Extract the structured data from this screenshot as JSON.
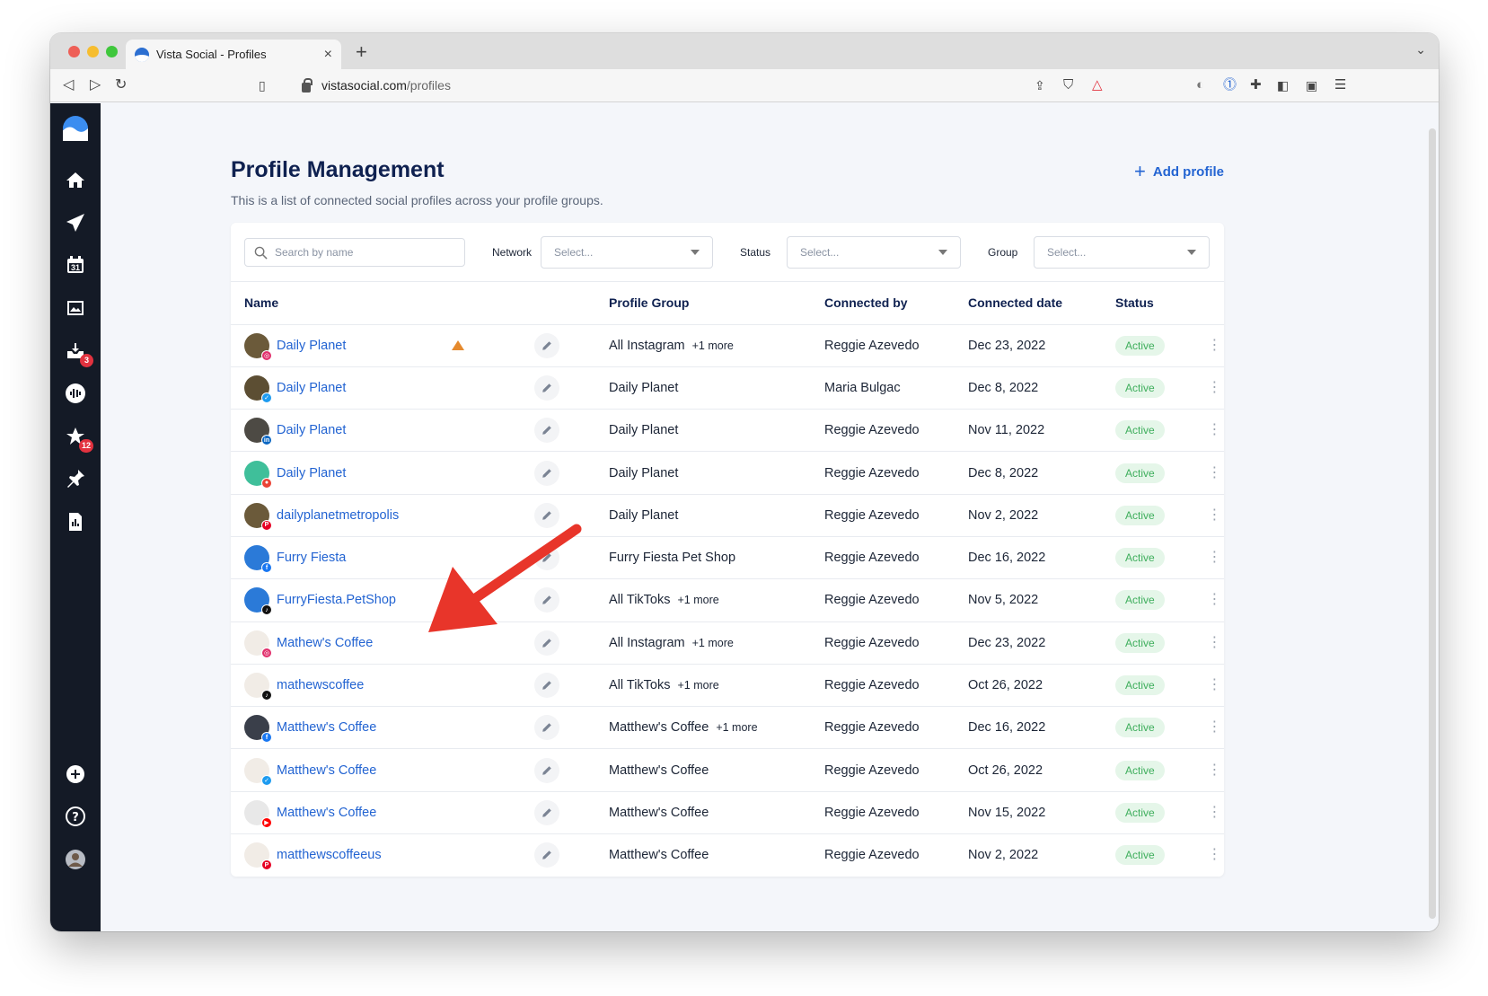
{
  "browser": {
    "tab_title": "Vista Social - Profiles",
    "url_host": "vistasocial.com",
    "url_path": "/profiles"
  },
  "sidebar": {
    "items": [
      {
        "name": "logo",
        "icon": "vista-logo-icon"
      },
      {
        "name": "home",
        "icon": "home-icon"
      },
      {
        "name": "publish",
        "icon": "paper-plane-icon"
      },
      {
        "name": "calendar",
        "icon": "calendar-icon",
        "text": "31"
      },
      {
        "name": "media",
        "icon": "image-icon"
      },
      {
        "name": "inbox",
        "icon": "inbox-icon",
        "badge": "3"
      },
      {
        "name": "listening",
        "icon": "soundwave-icon"
      },
      {
        "name": "reviews",
        "icon": "star-icon",
        "badge": "12"
      },
      {
        "name": "pins",
        "icon": "pin-icon"
      },
      {
        "name": "reports",
        "icon": "report-icon"
      }
    ],
    "bottom": [
      {
        "name": "add",
        "icon": "plus-circle-icon"
      },
      {
        "name": "help",
        "icon": "question-circle-icon"
      },
      {
        "name": "user",
        "icon": "user-avatar-icon"
      }
    ]
  },
  "page": {
    "title": "Profile Management",
    "subtitle": "This is a list of connected social profiles across your profile groups.",
    "add_profile": "Add profile"
  },
  "filters": {
    "search_placeholder": "Search by name",
    "network_label": "Network",
    "network_value": "Select...",
    "status_label": "Status",
    "status_value": "Select...",
    "group_label": "Group",
    "group_value": "Select..."
  },
  "table": {
    "columns": [
      "Name",
      "Profile Group",
      "Connected by",
      "Connected date",
      "Status"
    ],
    "rows": [
      {
        "name": "Daily Planet",
        "network": "instagram",
        "group": "All Instagram",
        "more": "+1 more",
        "by": "Reggie Azevedo",
        "date": "Dec 23, 2022",
        "status": "Active",
        "warning": true,
        "avatar_color": "#6b5a3a"
      },
      {
        "name": "Daily Planet",
        "network": "twitter",
        "group": "Daily Planet",
        "more": "",
        "by": "Maria Bulgac",
        "date": "Dec 8, 2022",
        "status": "Active",
        "avatar_color": "#5c4e33"
      },
      {
        "name": "Daily Planet",
        "network": "linkedin",
        "group": "Daily Planet",
        "more": "",
        "by": "Reggie Azevedo",
        "date": "Nov 11, 2022",
        "status": "Active",
        "avatar_color": "#4d4a44"
      },
      {
        "name": "Daily Planet",
        "network": "google",
        "group": "Daily Planet",
        "more": "",
        "by": "Reggie Azevedo",
        "date": "Dec 8, 2022",
        "status": "Active",
        "avatar_color": "#3fbf9a"
      },
      {
        "name": "dailyplanetmetropolis",
        "network": "pinterest",
        "group": "Daily Planet",
        "more": "",
        "by": "Reggie Azevedo",
        "date": "Nov 2, 2022",
        "status": "Active",
        "avatar_color": "#6b5a3a"
      },
      {
        "name": "Furry Fiesta",
        "network": "facebook",
        "group": "Furry Fiesta Pet Shop",
        "more": "",
        "by": "Reggie Azevedo",
        "date": "Dec 16, 2022",
        "status": "Active",
        "avatar_color": "#2b7ad8"
      },
      {
        "name": "FurryFiesta.PetShop",
        "network": "tiktok",
        "group": "All TikToks",
        "more": "+1 more",
        "by": "Reggie Azevedo",
        "date": "Nov 5, 2022",
        "status": "Active",
        "avatar_color": "#2b7ad8"
      },
      {
        "name": "Mathew's Coffee",
        "network": "instagram",
        "group": "All Instagram",
        "more": "+1 more",
        "by": "Reggie Azevedo",
        "date": "Dec 23, 2022",
        "status": "Active",
        "avatar_color": "#f1ece6"
      },
      {
        "name": "mathewscoffee",
        "network": "tiktok",
        "group": "All TikToks",
        "more": "+1 more",
        "by": "Reggie Azevedo",
        "date": "Oct 26, 2022",
        "status": "Active",
        "avatar_color": "#f1ece6"
      },
      {
        "name": "Matthew's Coffee",
        "network": "facebook",
        "group": "Matthew's Coffee",
        "more": "+1 more",
        "by": "Reggie Azevedo",
        "date": "Dec 16, 2022",
        "status": "Active",
        "avatar_color": "#3a3f4a"
      },
      {
        "name": "Matthew's Coffee",
        "network": "twitter",
        "group": "Matthew's Coffee",
        "more": "",
        "by": "Reggie Azevedo",
        "date": "Oct 26, 2022",
        "status": "Active",
        "avatar_color": "#f1ece6"
      },
      {
        "name": "Matthew's Coffee",
        "network": "youtube",
        "group": "Matthew's Coffee",
        "more": "",
        "by": "Reggie Azevedo",
        "date": "Nov 15, 2022",
        "status": "Active",
        "avatar_color": "#e8e8e8"
      },
      {
        "name": "matthewscoffeeus",
        "network": "pinterest",
        "group": "Matthew's Coffee",
        "more": "",
        "by": "Reggie Azevedo",
        "date": "Nov 2, 2022",
        "status": "Active",
        "avatar_color": "#f1ece6"
      }
    ]
  },
  "colors": {
    "accent": "#2364d2",
    "status_bg": "#e5f6e9",
    "status_text": "#3eae5c",
    "sidebar_bg": "#141a26",
    "annotation_arrow": "#e8352a",
    "networks": {
      "instagram": "#e1306c",
      "twitter": "#1d9bf0",
      "linkedin": "#0a66c2",
      "google": "#ea4335",
      "pinterest": "#e60023",
      "facebook": "#1877f2",
      "tiktok": "#111111",
      "youtube": "#ff0000"
    }
  }
}
